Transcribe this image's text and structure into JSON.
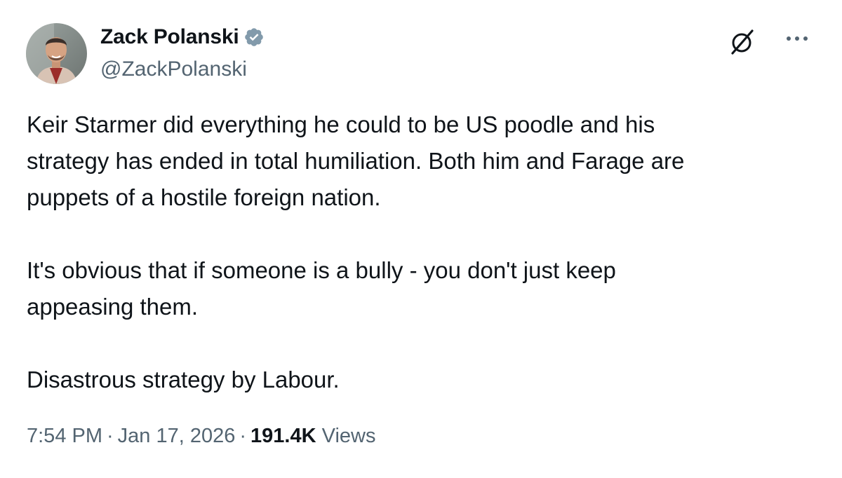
{
  "author": {
    "name": "Zack Polanski",
    "handle": "@ZackPolanski",
    "verified_icon": "verified-badge-icon",
    "verified_color": "#829aab"
  },
  "header_actions": {
    "grok_icon": "grok-icon",
    "more_icon": "more-horizontal-icon"
  },
  "tweet": {
    "lines": [
      "Keir Starmer did everything he could to be US poodle and his",
      "strategy has ended in total humiliation. Both him and Farage are",
      "puppets of a hostile foreign nation.",
      "It's obvious that if someone is a bully - you don't just keep",
      "appeasing them.",
      "Disastrous strategy by Labour."
    ]
  },
  "meta": {
    "time": "7:54 PM",
    "date": "Jan 17, 2026",
    "separator": "·",
    "views_count": "191.4K",
    "views_label": "Views"
  },
  "colors": {
    "text": "#0f1419",
    "secondary": "#536471",
    "background": "#ffffff"
  }
}
